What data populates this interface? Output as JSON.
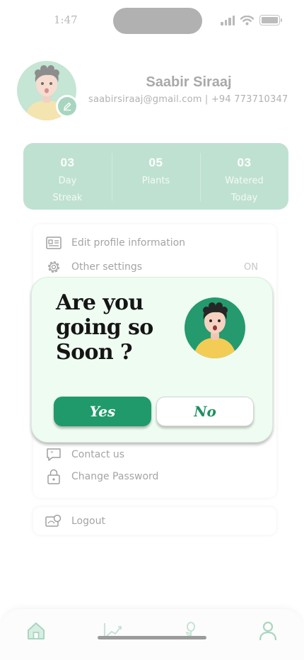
{
  "status_bar": {
    "time": "1:47",
    "icons": [
      "cellular-signal-icon",
      "wifi-icon",
      "battery-icon"
    ]
  },
  "profile": {
    "name": "Saabir Siraaj",
    "contact": "saabirsiraaj@gmail.com | +94 773710347",
    "avatar_icon": "user-avatar-illustration",
    "edit_icon": "pencil-icon"
  },
  "stats": [
    {
      "value": "03",
      "label_line1": "Day",
      "label_line2": "Streak"
    },
    {
      "value": "05",
      "label_line1": "Plants",
      "label_line2": ""
    },
    {
      "value": "03",
      "label_line1": "Watered",
      "label_line2": "Today"
    }
  ],
  "menu": {
    "items": [
      {
        "label": "Edit profile information",
        "icon": "id-card-icon"
      },
      {
        "label": "Other settings",
        "icon": "gear-icon",
        "toggle_text": "ON"
      },
      {
        "label": "Contact us",
        "icon": "chat-quote-icon"
      },
      {
        "label": "Change Password",
        "icon": "lock-icon"
      }
    ],
    "logout": {
      "label": "Logout",
      "icon": "logout-icon"
    }
  },
  "modal": {
    "title": "Are you going so Soon ?",
    "yes_label": "Yes",
    "no_label": "No",
    "avatar_icon": "user-avatar-illustration"
  },
  "bottom_nav": {
    "items": [
      "home-icon",
      "growth-chart-icon",
      "plant-icon",
      "profile-icon"
    ],
    "active": "home-icon"
  },
  "colors": {
    "accent_green": "#209a6a",
    "stats_bg": "#bfe1d1",
    "modal_bg": "#effcf2",
    "avatar_bg_light": "#c5e5d5",
    "avatar_bg_dark": "#249a6e"
  }
}
